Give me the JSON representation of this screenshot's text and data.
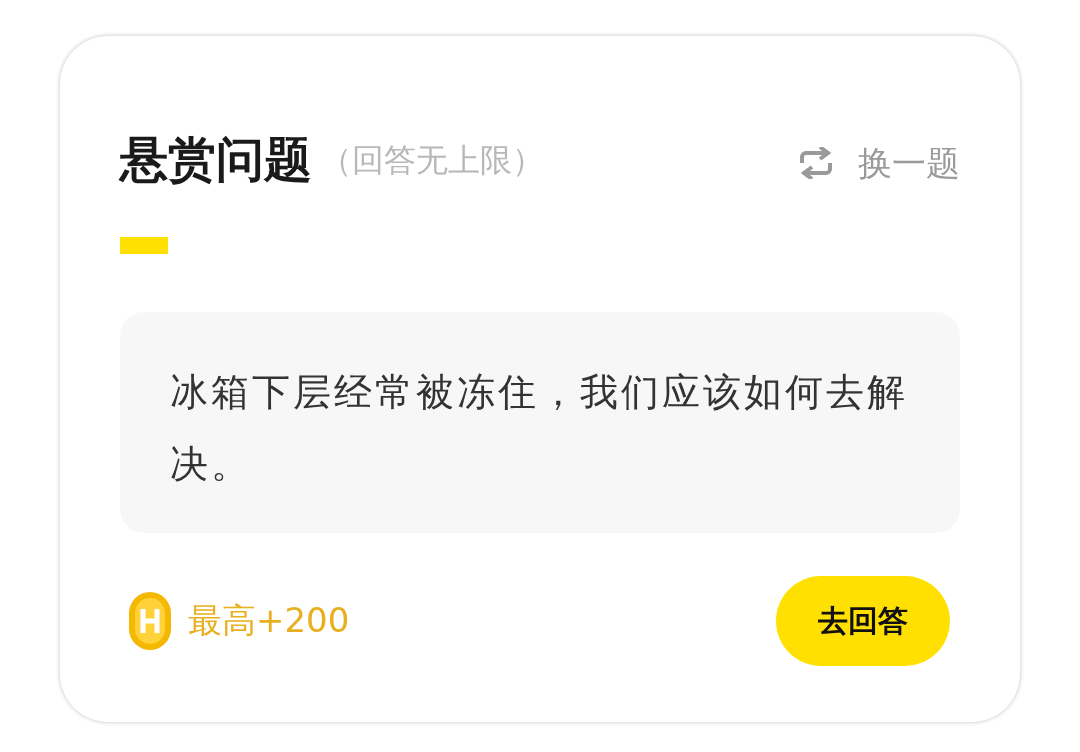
{
  "header": {
    "title": "悬赏问题",
    "subtitle": "（回答无上限）",
    "switch_label": "换一题"
  },
  "question": {
    "text": "冰箱下层经常被冻住，我们应该如何去解决。"
  },
  "reward": {
    "text": "最高+200"
  },
  "button": {
    "label": "去回答"
  }
}
